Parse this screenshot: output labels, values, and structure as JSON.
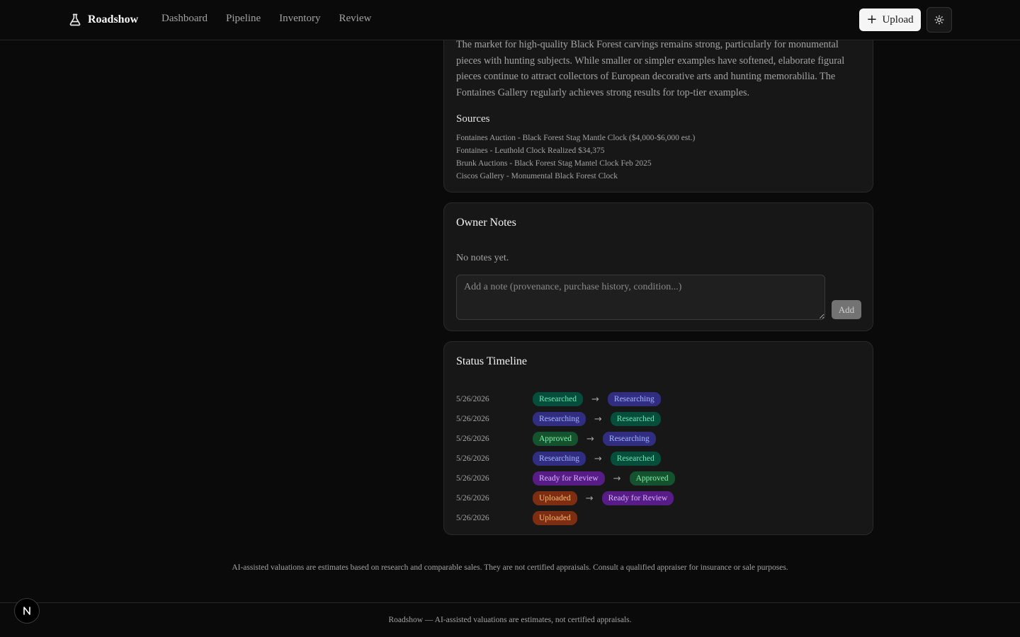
{
  "header": {
    "brand": "Roadshow",
    "brand_icon": "flask-icon",
    "nav": [
      "Dashboard",
      "Pipeline",
      "Inventory",
      "Review"
    ],
    "upload_label": "Upload",
    "theme_icon": "sun-icon"
  },
  "market": {
    "text": "The market for high-quality Black Forest carvings remains strong, particularly for monumental pieces with hunting subjects. While smaller or simpler examples have softened, elaborate figural pieces continue to attract collectors of European decorative arts and hunting memorabilia. The Fontaines Gallery regularly achieves strong results for top-tier examples.",
    "sources_title": "Sources",
    "sources": [
      "Fontaines Auction - Black Forest Stag Mantle Clock ($4,000-$6,000 est.)",
      "Fontaines - Leuthold Clock Realized $34,375",
      "Brunk Auctions - Black Forest Stag Mantel Clock Feb 2025",
      "Ciscos Gallery - Monumental Black Forest Clock"
    ]
  },
  "notes": {
    "title": "Owner Notes",
    "empty": "No notes yet.",
    "placeholder": "Add a note (provenance, purchase history, condition...)",
    "add_label": "Add"
  },
  "timeline": {
    "title": "Status Timeline",
    "rows": [
      {
        "date": "5/26/2026",
        "from": "Researched",
        "to": "Researching"
      },
      {
        "date": "5/26/2026",
        "from": "Researching",
        "to": "Researched"
      },
      {
        "date": "5/26/2026",
        "from": "Approved",
        "to": "Researching"
      },
      {
        "date": "5/26/2026",
        "from": "Researching",
        "to": "Researched"
      },
      {
        "date": "5/26/2026",
        "from": "Ready for Review",
        "to": "Approved"
      },
      {
        "date": "5/26/2026",
        "from": "Uploaded",
        "to": "Ready for Review"
      },
      {
        "date": "5/26/2026",
        "from": "Uploaded",
        "to": null
      }
    ],
    "status_colors": {
      "Researched": {
        "bg": "#064e3b",
        "fg": "#6ee7b7"
      },
      "Researching": {
        "bg": "#312e81",
        "fg": "#a5b4fc"
      },
      "Approved": {
        "bg": "#14532d",
        "fg": "#86efac"
      },
      "Ready for Review": {
        "bg": "#581c87",
        "fg": "#d8b4fe"
      },
      "Uploaded": {
        "bg": "#7c2d12",
        "fg": "#fdba74"
      }
    },
    "arrow": "→"
  },
  "disclaimer": "AI-assisted valuations are estimates based on research and comparable sales. They are not certified appraisals. Consult a qualified appraiser for insurance or sale purposes.",
  "footer": "Roadshow — AI-assisted valuations are estimates, not certified appraisals.",
  "dev_badge": {
    "icon": "nextjs-icon",
    "letter": "N"
  }
}
